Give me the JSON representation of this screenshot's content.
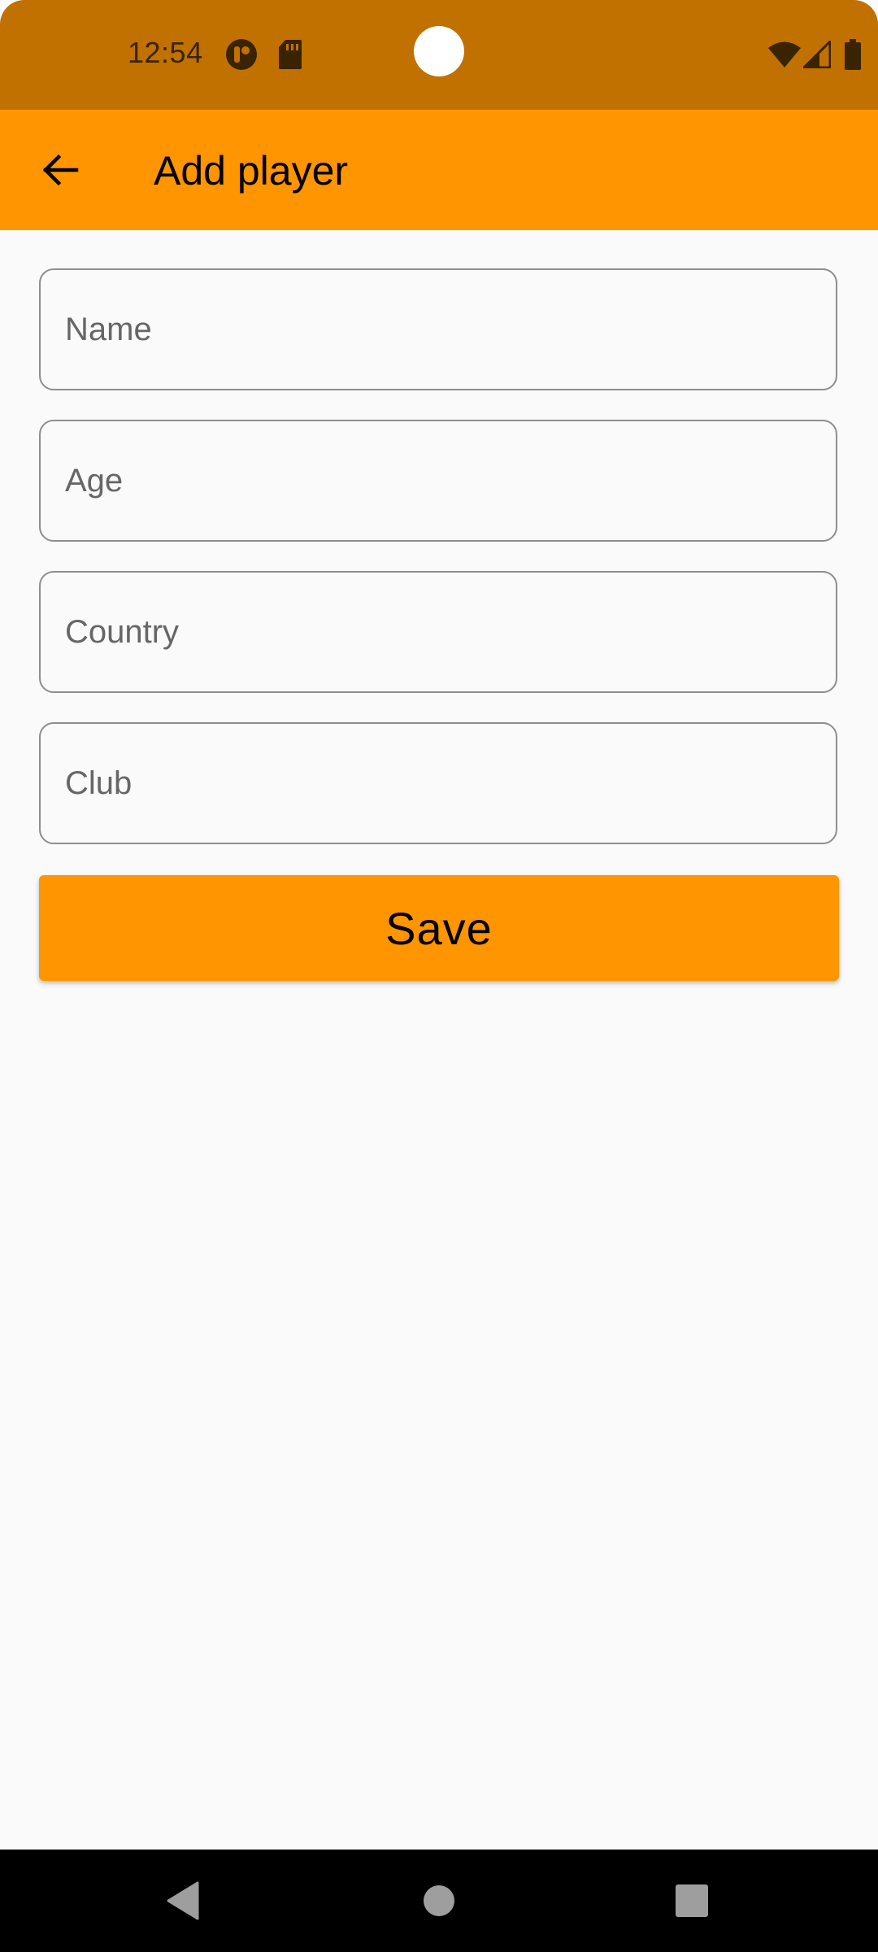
{
  "status_bar": {
    "time": "12:54",
    "icons": [
      "notification-app-icon",
      "sd-card-icon",
      "wifi-icon",
      "cell-signal-icon",
      "battery-icon"
    ]
  },
  "app_bar": {
    "title": "Add player",
    "back_icon": "arrow-back-icon"
  },
  "form": {
    "name_placeholder": "Name",
    "age_placeholder": "Age",
    "country_placeholder": "Country",
    "club_placeholder": "Club",
    "save_label": "Save"
  },
  "nav_bar": {
    "icons": [
      "nav-back-icon",
      "nav-home-icon",
      "nav-recents-icon"
    ]
  },
  "colors": {
    "status_bar": "#c17100",
    "accent": "#ff9500",
    "background": "#fafafa",
    "field_border": "#8e8e8e",
    "placeholder": "#666666"
  }
}
